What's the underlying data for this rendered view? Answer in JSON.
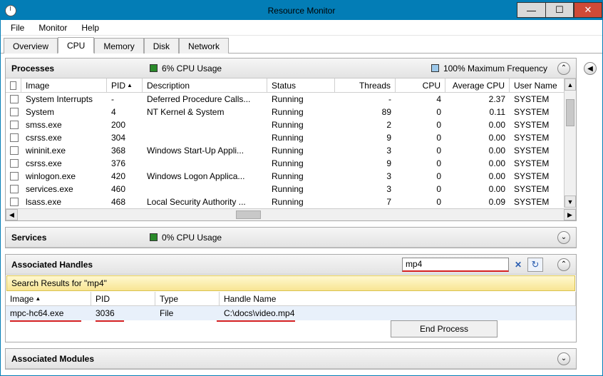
{
  "window": {
    "title": "Resource Monitor"
  },
  "title_buttons": {
    "min": "—",
    "max": "☐",
    "close": "✕"
  },
  "menu": {
    "file": "File",
    "monitor": "Monitor",
    "help": "Help"
  },
  "tabs": {
    "overview": "Overview",
    "cpu": "CPU",
    "memory": "Memory",
    "disk": "Disk",
    "network": "Network"
  },
  "processes": {
    "title": "Processes",
    "metric_cpu": "6% CPU Usage",
    "metric_freq": "100% Maximum Frequency",
    "cols": {
      "image": "Image",
      "pid": "PID",
      "desc": "Description",
      "status": "Status",
      "threads": "Threads",
      "cpu": "CPU",
      "avg": "Average CPU",
      "user": "User Name"
    },
    "rows": [
      {
        "image": "System Interrupts",
        "pid": "-",
        "desc": "Deferred Procedure Calls...",
        "status": "Running",
        "threads": "-",
        "cpu": "4",
        "avg": "2.37",
        "user": "SYSTEM"
      },
      {
        "image": "System",
        "pid": "4",
        "desc": "NT Kernel & System",
        "status": "Running",
        "threads": "89",
        "cpu": "0",
        "avg": "0.11",
        "user": "SYSTEM"
      },
      {
        "image": "smss.exe",
        "pid": "200",
        "desc": "",
        "status": "Running",
        "threads": "2",
        "cpu": "0",
        "avg": "0.00",
        "user": "SYSTEM"
      },
      {
        "image": "csrss.exe",
        "pid": "304",
        "desc": "",
        "status": "Running",
        "threads": "9",
        "cpu": "0",
        "avg": "0.00",
        "user": "SYSTEM"
      },
      {
        "image": "wininit.exe",
        "pid": "368",
        "desc": "Windows Start-Up Appli...",
        "status": "Running",
        "threads": "3",
        "cpu": "0",
        "avg": "0.00",
        "user": "SYSTEM"
      },
      {
        "image": "csrss.exe",
        "pid": "376",
        "desc": "",
        "status": "Running",
        "threads": "9",
        "cpu": "0",
        "avg": "0.00",
        "user": "SYSTEM"
      },
      {
        "image": "winlogon.exe",
        "pid": "420",
        "desc": "Windows Logon Applica...",
        "status": "Running",
        "threads": "3",
        "cpu": "0",
        "avg": "0.00",
        "user": "SYSTEM"
      },
      {
        "image": "services.exe",
        "pid": "460",
        "desc": "",
        "status": "Running",
        "threads": "3",
        "cpu": "0",
        "avg": "0.00",
        "user": "SYSTEM"
      },
      {
        "image": "lsass.exe",
        "pid": "468",
        "desc": "Local Security Authority ...",
        "status": "Running",
        "threads": "7",
        "cpu": "0",
        "avg": "0.09",
        "user": "SYSTEM"
      }
    ]
  },
  "services": {
    "title": "Services",
    "metric": "0% CPU Usage"
  },
  "handles": {
    "title": "Associated Handles",
    "search_value": "mp4",
    "search_results_label": "Search Results for \"mp4\"",
    "cols": {
      "image": "Image",
      "pid": "PID",
      "type": "Type",
      "name": "Handle Name"
    },
    "rows": [
      {
        "image": "mpc-hc64.exe",
        "pid": "3036",
        "type": "File",
        "name": "C:\\docs\\video.mp4"
      }
    ],
    "end_process": "End Process"
  },
  "modules": {
    "title": "Associated Modules"
  },
  "glyphs": {
    "up": "▲",
    "down": "▼",
    "left": "◀",
    "right": "▶",
    "collapse": "⌃",
    "expand": "⌄",
    "refresh": "↻"
  }
}
